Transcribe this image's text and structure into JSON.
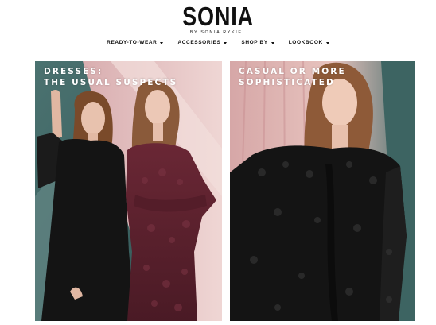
{
  "header": {
    "logo": "SONIA",
    "tagline": "BY SONIA RYKIEL"
  },
  "nav": {
    "items": [
      {
        "label": "READY-TO-WEAR"
      },
      {
        "label": "ACCESSORIES"
      },
      {
        "label": "SHOP BY"
      },
      {
        "label": "LOOKBOOK"
      }
    ]
  },
  "panels": {
    "left": {
      "heading_line1": "DRESSES:",
      "heading_line2": "THE USUAL SUSPECTS"
    },
    "right": {
      "heading_line1": "CASUAL OR MORE",
      "heading_line2": "SOPHISTICATED"
    }
  },
  "colors": {
    "teal_background": "#3f6a6a",
    "blush_background": "#e3bcb8",
    "burgundy_dress": "#5e2330",
    "black_dress": "#141414",
    "heading_text": "#ffffff"
  }
}
